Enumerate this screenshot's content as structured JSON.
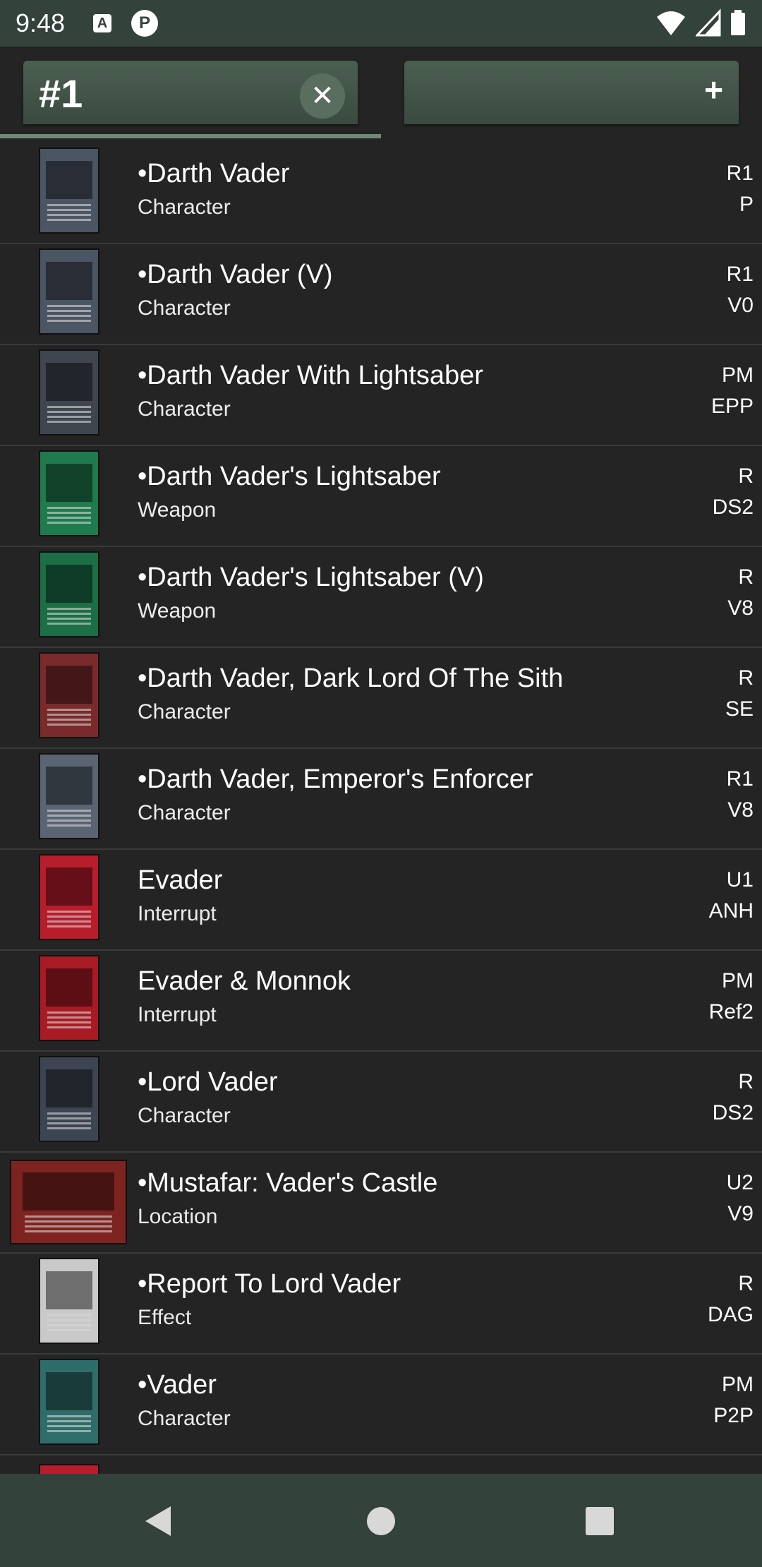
{
  "status_bar": {
    "time": "9:48",
    "icons_left": [
      "a-box-icon",
      "p-circle-icon"
    ],
    "icons_right": [
      "wifi-icon",
      "signal-icon",
      "battery-icon"
    ]
  },
  "tabs": [
    {
      "label": "#1",
      "selected": true,
      "action_icon": "close-icon",
      "action_glyph": "✕"
    },
    {
      "label": "",
      "selected": false,
      "action_icon": "plus-icon",
      "action_glyph": "+"
    }
  ],
  "cards": [
    {
      "title": "•Darth Vader",
      "type": "Character",
      "rarity": "R1",
      "set": "P",
      "thumb_color": "#4b5563",
      "thumb_shape": "portrait"
    },
    {
      "title": "•Darth Vader (V)",
      "type": "Character",
      "rarity": "R1",
      "set": "V0",
      "thumb_color": "#4b5563",
      "thumb_shape": "portrait"
    },
    {
      "title": "•Darth Vader With Lightsaber",
      "type": "Character",
      "rarity": "PM",
      "set": "EPP",
      "thumb_color": "#3f4650",
      "thumb_shape": "portrait"
    },
    {
      "title": "•Darth Vader's Lightsaber",
      "type": "Weapon",
      "rarity": "R",
      "set": "DS2",
      "thumb_color": "#1f7a4d",
      "thumb_shape": "portrait"
    },
    {
      "title": "•Darth Vader's Lightsaber (V)",
      "type": "Weapon",
      "rarity": "R",
      "set": "V8",
      "thumb_color": "#1b6e45",
      "thumb_shape": "portrait"
    },
    {
      "title": "•Darth Vader, Dark Lord Of The Sith",
      "type": "Character",
      "rarity": "R",
      "set": "SE",
      "thumb_color": "#7a2a2a",
      "thumb_shape": "portrait"
    },
    {
      "title": "•Darth Vader, Emperor's Enforcer",
      "type": "Character",
      "rarity": "R1",
      "set": "V8",
      "thumb_color": "#5a6473",
      "thumb_shape": "portrait"
    },
    {
      "title": "Evader",
      "type": "Interrupt",
      "rarity": "U1",
      "set": "ANH",
      "thumb_color": "#b81d2c",
      "thumb_shape": "portrait"
    },
    {
      "title": "Evader & Monnok",
      "type": "Interrupt",
      "rarity": "PM",
      "set": "Ref2",
      "thumb_color": "#a81b25",
      "thumb_shape": "portrait"
    },
    {
      "title": "•Lord Vader",
      "type": "Character",
      "rarity": "R",
      "set": "DS2",
      "thumb_color": "#3d4552",
      "thumb_shape": "portrait"
    },
    {
      "title": "•Mustafar: Vader's Castle",
      "type": "Location",
      "rarity": "U2",
      "set": "V9",
      "thumb_color": "#7e2420",
      "thumb_shape": "landscape"
    },
    {
      "title": "•Report To Lord Vader",
      "type": "Effect",
      "rarity": "R",
      "set": "DAG",
      "thumb_color": "#c9c9c9",
      "thumb_shape": "portrait"
    },
    {
      "title": "•Vader",
      "type": "Character",
      "rarity": "PM",
      "set": "P2P",
      "thumb_color": "#2f6d6a",
      "thumb_shape": "portrait"
    }
  ],
  "partial_card": {
    "thumb_color": "#b81d2c"
  },
  "nav_bar": {
    "buttons": [
      "back-icon",
      "home-icon",
      "recents-icon"
    ]
  }
}
